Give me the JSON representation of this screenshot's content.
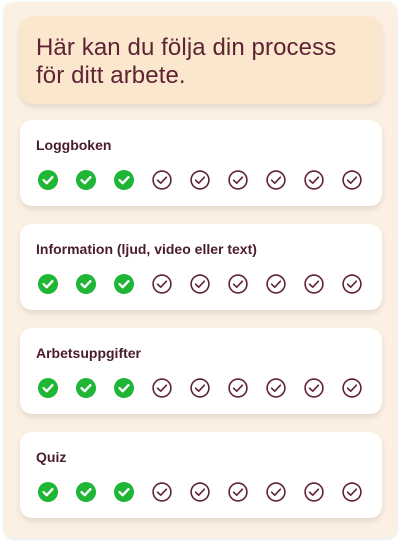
{
  "header": {
    "title_line1": "Här kan du följa din process",
    "title_line2": "för ditt arbete."
  },
  "colors": {
    "panel_bg": "#fbf0e2",
    "header_bg": "#fbe6ce",
    "title_text": "#5e2434",
    "done_fill": "#1fb535",
    "pending_stroke": "#5e2434"
  },
  "sections": [
    {
      "title": "Loggboken",
      "completed": 3,
      "total": 9
    },
    {
      "title": "Information (ljud, video eller text)",
      "completed": 3,
      "total": 9
    },
    {
      "title": "Arbetsuppgifter",
      "completed": 3,
      "total": 9
    },
    {
      "title": "Quiz",
      "completed": 3,
      "total": 9
    }
  ]
}
